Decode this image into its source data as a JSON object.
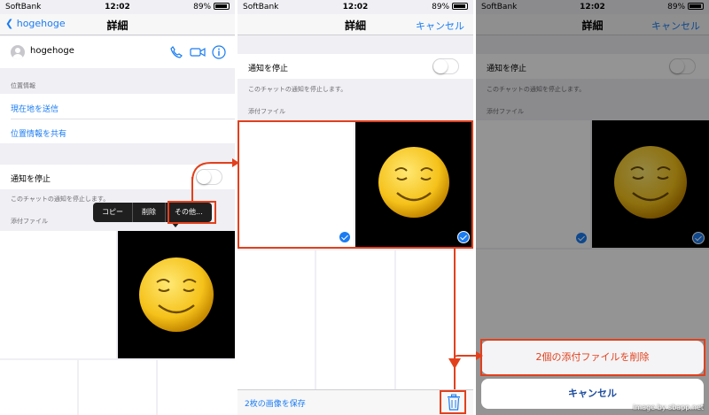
{
  "status_bar": {
    "carrier": "SoftBank",
    "time": "12:02",
    "battery": "89%"
  },
  "panel1": {
    "nav": {
      "back_label": "hogehoge",
      "title": "詳細"
    },
    "contact_name": "hogehoge",
    "location_section": "位置情報",
    "send_location": "現在地を送信",
    "share_location": "位置情報を共有",
    "mute_label": "通知を停止",
    "mute_desc": "このチャットの通知を停止します。",
    "attachments_section": "添付ファイル",
    "menu": {
      "copy": "コピー",
      "delete": "削除",
      "more": "その他..."
    }
  },
  "panel2": {
    "nav": {
      "title": "詳細",
      "cancel": "キャンセル"
    },
    "mute_label": "通知を停止",
    "mute_desc": "このチャットの通知を停止します。",
    "attachments_section": "添付ファイル",
    "save_label": "2枚の画像を保存"
  },
  "panel3": {
    "nav": {
      "title": "詳細",
      "cancel": "キャンセル"
    },
    "mute_label": "通知を停止",
    "mute_desc": "このチャットの通知を停止します。",
    "attachments_section": "添付ファイル",
    "delete_action": "2個の添付ファイルを削除",
    "cancel_action": "キャンセル",
    "watermark": "image by sbapp.net"
  },
  "colors": {
    "ios_blue": "#1a7cf3",
    "annotation_red": "#e2401c",
    "destructive_red": "#e2401c",
    "emoji_yellow": "#f5c21a"
  },
  "icons": [
    "back-chevron-icon",
    "phone-icon",
    "video-icon",
    "info-icon",
    "checkmark-icon",
    "trash-icon",
    "battery-icon",
    "wifi-icon",
    "emoji-smiley-icon"
  ]
}
